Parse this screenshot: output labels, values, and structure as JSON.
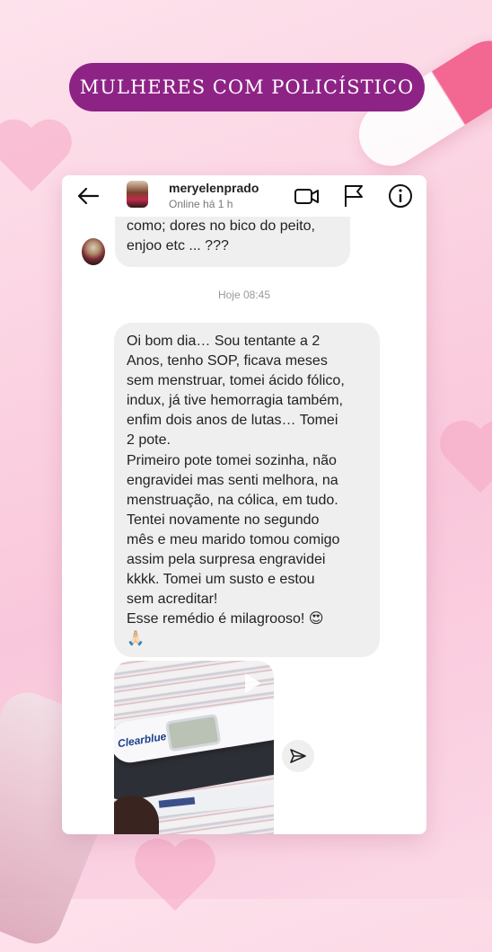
{
  "banner": {
    "text": "MULHERES COM POLICÍSTICO"
  },
  "chat": {
    "username": "meryelenprado",
    "status": "Online há 1 h",
    "icons": [
      "back-arrow-icon",
      "video-call-icon",
      "flag-icon",
      "info-icon"
    ]
  },
  "messages": {
    "first": "como; dores no bico do peito,\nenjoo etc ... ???",
    "timestamp": "Hoje 08:45",
    "second": [
      "Oi bom dia… Sou tentante a 2",
      "Anos, tenho SOP, ficava meses",
      "sem menstruar, tomei ácido fólico,",
      "indux, já tive hemorragia também,",
      "enfim dois anos de lutas… Tomei",
      "2 pote.",
      "Primeiro pote tomei sozinha, não",
      "engravidei mas senti melhora, na",
      "menstruação, na cólica, em tudo.",
      "Tentei novamente no segundo",
      "mês e meu marido tomou comigo",
      "assim pela surpresa engravidei",
      "kkkk. Tomei um susto e estou",
      "sem acreditar!",
      " Esse remédio é milagrooso! 😍",
      "🙏🏻"
    ],
    "media_brand": "Clearblue"
  },
  "colors": {
    "banner": "#8e2386",
    "bubble": "#efefef",
    "background": "#fbd3e2"
  }
}
